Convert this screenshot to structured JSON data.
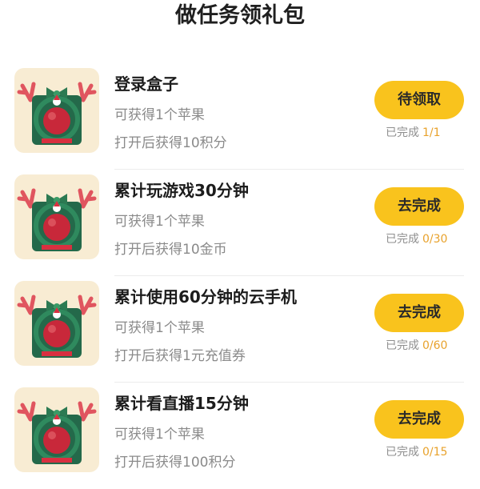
{
  "header": {
    "title": "做任务领礼包"
  },
  "tasks": [
    {
      "title": "登录盒子",
      "reward": "可获得1个苹果",
      "bonus": "打开后获得10积分",
      "button": "待领取",
      "progress_label": "已完成",
      "progress_value": "1/1"
    },
    {
      "title": "累计玩游戏30分钟",
      "reward": "可获得1个苹果",
      "bonus": "打开后获得10金币",
      "button": "去完成",
      "progress_label": "已完成",
      "progress_value": "0/30"
    },
    {
      "title": "累计使用60分钟的云手机",
      "reward": "可获得1个苹果",
      "bonus": "打开后获得1元充值券",
      "button": "去完成",
      "progress_label": "已完成",
      "progress_value": "0/60"
    },
    {
      "title": "累计看直播15分钟",
      "reward": "可获得1个苹果",
      "bonus": "打开后获得100积分",
      "button": "去完成",
      "progress_label": "已完成",
      "progress_value": "0/15"
    }
  ],
  "colors": {
    "button_bg": "#f9c31d",
    "progress_value": "#e8a22c",
    "thumb_bg": "#f8ecd3"
  },
  "icons": {
    "thumbnail": "christmas-apple-gift-icon"
  }
}
